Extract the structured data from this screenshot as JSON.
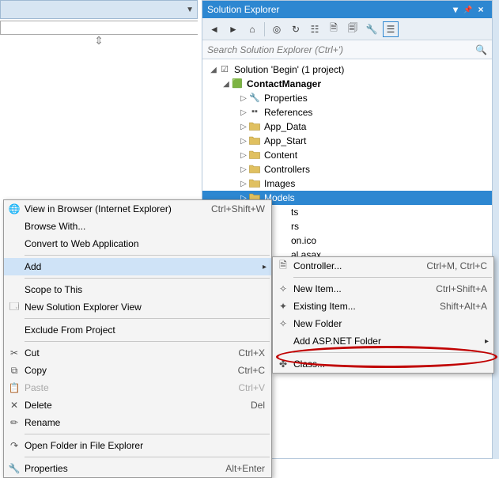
{
  "left_panel": {
    "dropdown": "▼",
    "splitter": "⇕"
  },
  "solution_explorer": {
    "title": "Solution Explorer",
    "buttons": {
      "menu": "▾",
      "pin": "📌",
      "close": "×"
    },
    "toolbar": {
      "back": "◄",
      "fwd": "►",
      "home": "⌂",
      "scope": "◎",
      "refresh": "↻",
      "collapse": "☷",
      "showall": "🗎",
      "props": "🗐",
      "wrench": "🔧",
      "view": "☰"
    },
    "search_placeholder": "Search Solution Explorer (Ctrl+')",
    "tree": {
      "solution": "Solution 'Begin' (1 project)",
      "project": "ContactManager",
      "items": [
        {
          "label": "Properties",
          "icon": "🔧"
        },
        {
          "label": "References",
          "icon": "▪▪"
        },
        {
          "label": "App_Data",
          "icon": "folder"
        },
        {
          "label": "App_Start",
          "icon": "folder"
        },
        {
          "label": "Content",
          "icon": "folder"
        },
        {
          "label": "Controllers",
          "icon": "folder"
        },
        {
          "label": "Images",
          "icon": "folder"
        },
        {
          "label": "Models",
          "icon": "folder",
          "selected": true
        },
        {
          "label": "ts",
          "partial": true
        },
        {
          "label": "rs",
          "partial": true
        },
        {
          "label": "on.ico",
          "partial": true
        },
        {
          "label": "al.asax",
          "partial": true
        }
      ]
    }
  },
  "context_menu": [
    {
      "icon": "🌐",
      "label": "View in Browser (Internet Explorer)",
      "shortcut": "Ctrl+Shift+W"
    },
    {
      "label": "Browse With..."
    },
    {
      "label": "Convert to Web Application"
    },
    {
      "sep": true
    },
    {
      "label": "Add",
      "highlight": true,
      "arrow": true
    },
    {
      "sep": true
    },
    {
      "label": "Scope to This"
    },
    {
      "icon": "🗔",
      "label": "New Solution Explorer View"
    },
    {
      "sep": true
    },
    {
      "label": "Exclude From Project"
    },
    {
      "sep": true
    },
    {
      "icon": "✂",
      "label": "Cut",
      "shortcut": "Ctrl+X"
    },
    {
      "icon": "⧉",
      "label": "Copy",
      "shortcut": "Ctrl+C"
    },
    {
      "icon": "📋",
      "label": "Paste",
      "shortcut": "Ctrl+V",
      "disabled": true
    },
    {
      "icon": "✕",
      "label": "Delete",
      "shortcut": "Del"
    },
    {
      "icon": "✏",
      "label": "Rename"
    },
    {
      "sep": true
    },
    {
      "icon": "↷",
      "label": "Open Folder in File Explorer"
    },
    {
      "sep": true
    },
    {
      "icon": "🔧",
      "label": "Properties",
      "shortcut": "Alt+Enter"
    }
  ],
  "add_submenu": [
    {
      "icon": "🗎",
      "label": "Controller...",
      "shortcut": "Ctrl+M, Ctrl+C"
    },
    {
      "sep": true
    },
    {
      "icon": "✧",
      "label": "New Item...",
      "shortcut": "Ctrl+Shift+A"
    },
    {
      "icon": "✦",
      "label": "Existing Item...",
      "shortcut": "Shift+Alt+A"
    },
    {
      "icon": "✧",
      "label": "New Folder"
    },
    {
      "label": "Add ASP.NET Folder",
      "arrow": true
    },
    {
      "sep": true
    },
    {
      "icon": "✤",
      "label": "Class..."
    }
  ]
}
